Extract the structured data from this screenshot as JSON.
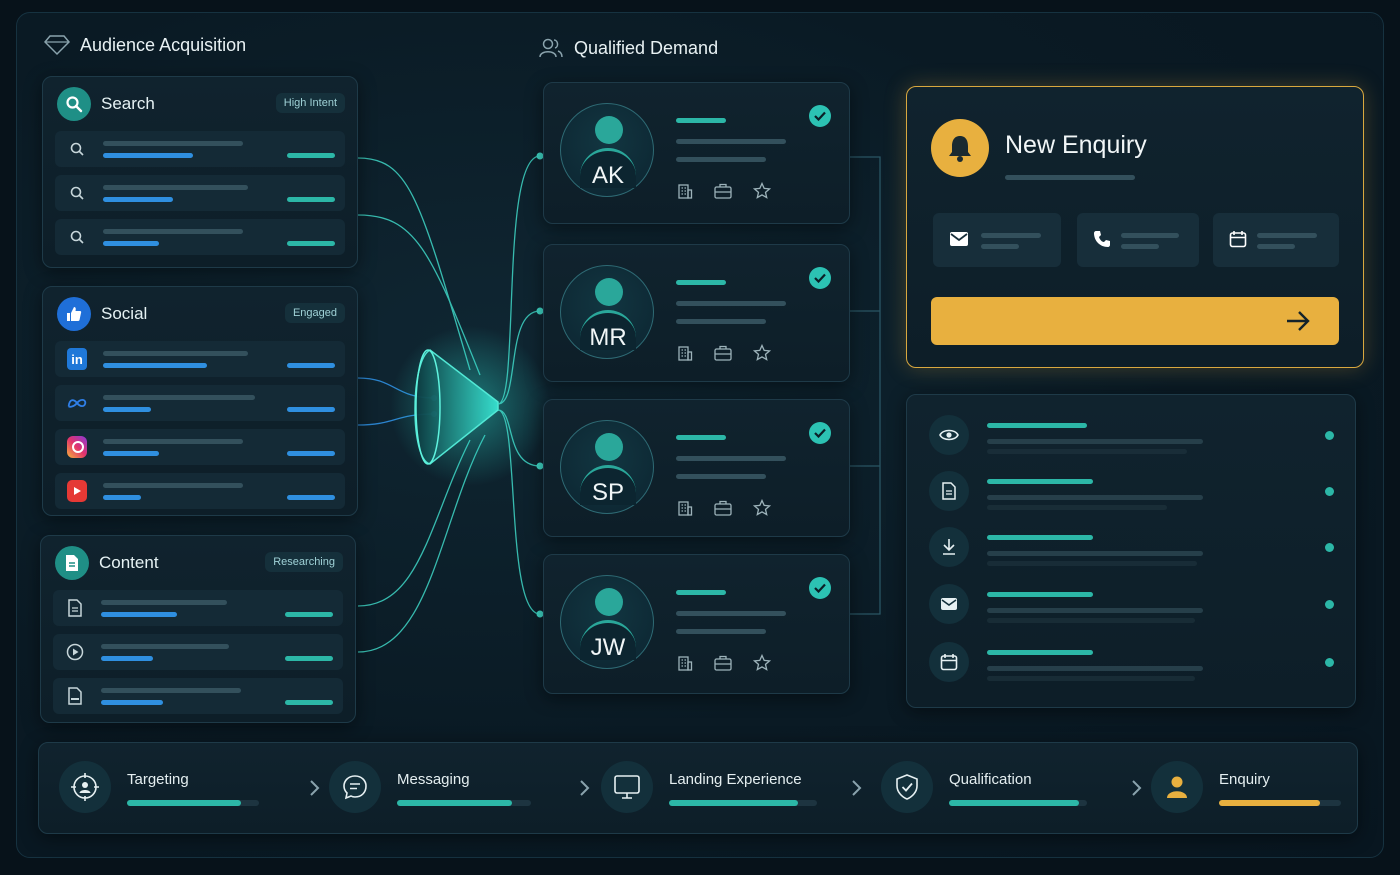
{
  "acquisition": {
    "title": "Audience Acquisition",
    "search": {
      "title": "Search",
      "badge": "High Intent"
    },
    "social": {
      "title": "Social",
      "badge": "Engaged"
    },
    "content": {
      "title": "Content",
      "badge": "Researching"
    }
  },
  "demand": {
    "title": "Qualified Demand",
    "leads": [
      {
        "initials": "AK"
      },
      {
        "initials": "MR"
      },
      {
        "initials": "SP"
      },
      {
        "initials": "JW"
      }
    ]
  },
  "enquiry": {
    "title": "New Enquiry",
    "channels": [
      "mail-icon",
      "phone-icon",
      "calendar-icon"
    ]
  },
  "activity": {
    "icons": [
      "eye-icon",
      "document-icon",
      "download-icon",
      "mail-icon",
      "calendar-icon"
    ]
  },
  "pipeline": {
    "stages": [
      {
        "label": "Targeting",
        "progress": 0.86
      },
      {
        "label": "Messaging",
        "progress": 0.86
      },
      {
        "label": "Landing Experience",
        "progress": 0.87
      },
      {
        "label": "Qualification",
        "progress": 0.94
      },
      {
        "label": "Enquiry",
        "progress": 0.83
      }
    ]
  },
  "colors": {
    "teal": "#2cb7a7",
    "blue": "#2f8fe0",
    "gold": "#e8b03f",
    "background": "#07121a"
  }
}
